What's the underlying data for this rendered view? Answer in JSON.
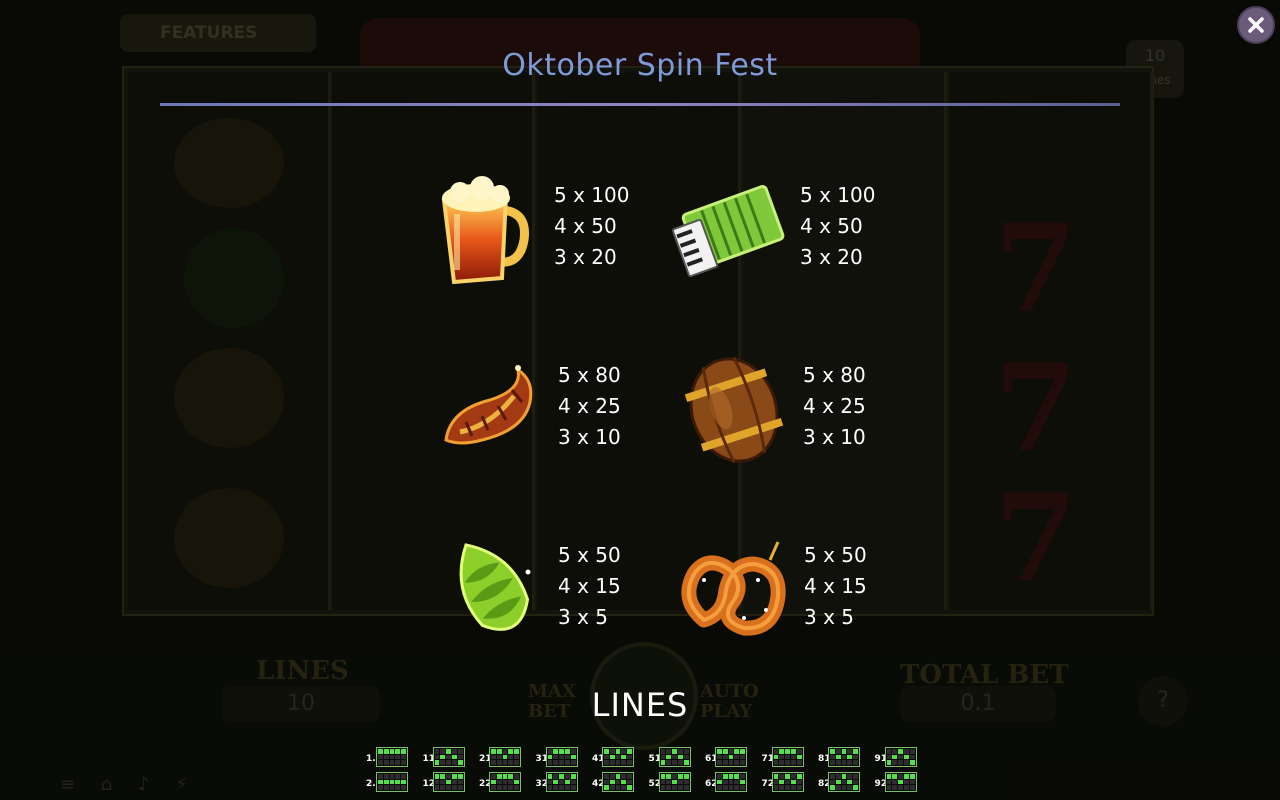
{
  "game": {
    "title": "Oktober Spin Fest",
    "close_label": "close"
  },
  "background": {
    "features_label": "FEATURES",
    "lines_badge_value": "10",
    "lines_badge_label": "Lines",
    "lines_label": "LINES",
    "lines_value": "10",
    "max_bet_label": "MAX BET",
    "auto_play_label": "AUTO PLAY",
    "total_bet_label": "TOTAL BET",
    "total_bet_value": "0.1",
    "help_label": "?"
  },
  "paytable": [
    {
      "symbol": "beer-mug",
      "icon": "beer-mug-icon",
      "payouts": [
        "5 x 100",
        "4 x 50",
        "3 x 20"
      ]
    },
    {
      "symbol": "accordion",
      "icon": "accordion-icon",
      "payouts": [
        "5 x 100",
        "4 x 50",
        "3 x 20"
      ]
    },
    {
      "symbol": "sausage",
      "icon": "sausage-icon",
      "payouts": [
        "5 x 80",
        "4 x 25",
        "3 x 10"
      ]
    },
    {
      "symbol": "barrel",
      "icon": "barrel-icon",
      "payouts": [
        "5 x 80",
        "4 x 25",
        "3 x 10"
      ]
    },
    {
      "symbol": "hops",
      "icon": "hops-icon",
      "payouts": [
        "5 x 50",
        "4 x 15",
        "3 x 5"
      ]
    },
    {
      "symbol": "pretzel",
      "icon": "pretzel-icon",
      "payouts": [
        "5 x 50",
        "4 x 15",
        "3 x 5"
      ]
    }
  ],
  "lines_section": {
    "heading": "LINES",
    "rows": [
      [
        "1.",
        "11.",
        "21.",
        "31.",
        "41.",
        "51.",
        "61.",
        "71.",
        "81.",
        "91."
      ],
      [
        "2.",
        "12.",
        "22.",
        "32.",
        "42.",
        "52.",
        "62.",
        "72.",
        "82.",
        "92."
      ]
    ]
  },
  "colors": {
    "title": "#7e9ad8",
    "rule": "#8d84c6",
    "line_on": "#54e04a"
  }
}
